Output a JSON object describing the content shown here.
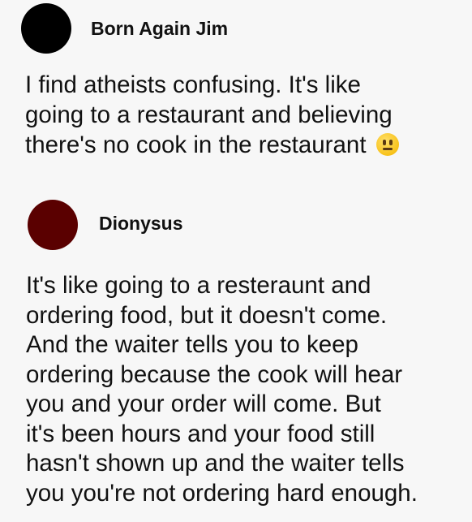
{
  "posts": [
    {
      "author": "Born Again Jim",
      "avatar_color": "#000000",
      "text": "I find atheists confusing. It's like\ngoing to a restaurant and believing\nthere's no cook in the restaurant",
      "emoji": "neutral-face-icon"
    },
    {
      "author": "Dionysus",
      "avatar_color": "#5a0000",
      "text": "It's like going to a resteraunt and\nordering food, but it doesn't come.\nAnd the waiter tells you to keep\nordering because the cook will hear\nyou and your order will come. But\nit's been hours and your food still\nhasn't shown up and the waiter tells\nyou you're not ordering hard enough."
    }
  ]
}
